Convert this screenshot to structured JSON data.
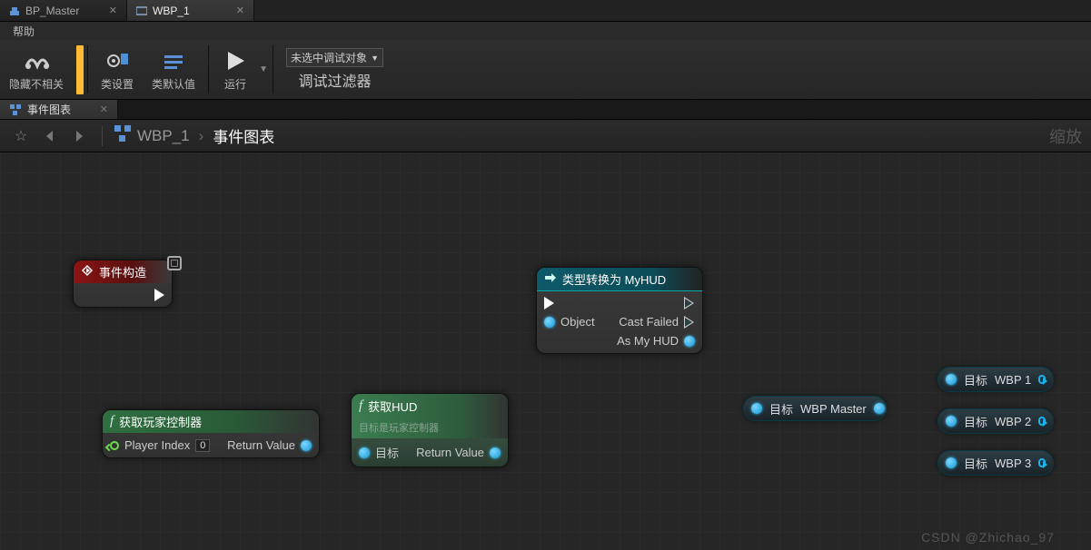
{
  "tabs": [
    {
      "label": "BP_Master",
      "active": false
    },
    {
      "label": "WBP_1",
      "active": true
    }
  ],
  "menu": {
    "help": "帮助"
  },
  "toolbar": {
    "hide_unrelated": "隐藏不相关",
    "class_settings": "类设置",
    "class_defaults": "类默认值",
    "play": "运行",
    "debug_target": "未选中调试对象",
    "debug_filter": "调试过滤器"
  },
  "sub_tab": {
    "event_graph": "事件图表"
  },
  "breadcrumb": {
    "wbp": "WBP_1",
    "graph": "事件图表",
    "zoom": "缩放"
  },
  "nodes": {
    "construct": {
      "title": "事件构造"
    },
    "get_player_controller": {
      "title": "获取玩家控制器",
      "player_index_label": "Player Index",
      "player_index_value": "0",
      "return_label": "Return Value"
    },
    "get_hud": {
      "title": "获取HUD",
      "subtitle": "目标是玩家控制器",
      "target_label": "目标",
      "return_label": "Return Value"
    },
    "cast": {
      "title": "类型转换为 MyHUD",
      "object_label": "Object",
      "cast_failed": "Cast Failed",
      "as_hud": "As My HUD"
    },
    "wbp_master": {
      "target": "目标",
      "name": "WBP Master"
    },
    "wbp1": {
      "target": "目标",
      "name": "WBP 1"
    },
    "wbp2": {
      "target": "目标",
      "name": "WBP 2"
    },
    "wbp3": {
      "target": "目标",
      "name": "WBP 3"
    }
  },
  "watermark": "CSDN @Zhichao_97"
}
